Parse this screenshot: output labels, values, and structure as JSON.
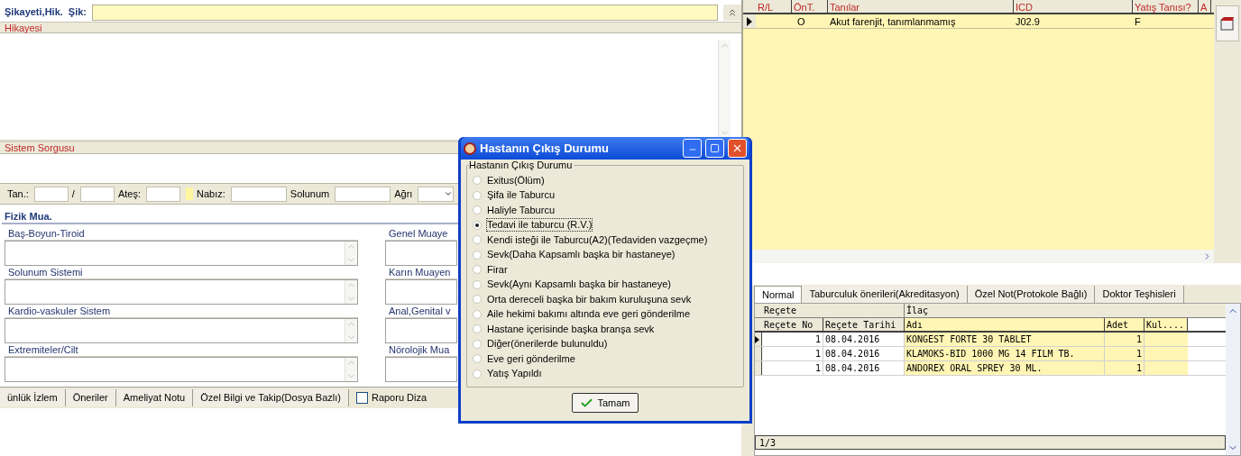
{
  "complaint": {
    "title": "Şikayeti,Hik.",
    "label": "Şik:"
  },
  "history": {
    "label": "Hikayesi"
  },
  "system_query": {
    "label": "Sistem Sorgusu"
  },
  "vitals": [
    {
      "label": "Tan.:",
      "kind": "field"
    },
    {
      "label": "/",
      "kind": "field"
    },
    {
      "label": "Ateş:",
      "kind": "field"
    },
    {
      "label": "Nabız:",
      "kind": "field",
      "marker": true
    },
    {
      "label": "Solunum",
      "kind": "field"
    },
    {
      "label": "Ağrı",
      "kind": "dropdown"
    }
  ],
  "physical_exam": {
    "title": "Fizik Mua.",
    "left_sections": [
      {
        "label": "Baş-Boyun-Tiroid"
      },
      {
        "label": "Solunum Sistemi"
      },
      {
        "label": "Kardio-vaskuler Sistem"
      },
      {
        "label": "Extremiteler/Cilt"
      }
    ],
    "right_sections": [
      {
        "label": "Genel Muaye"
      },
      {
        "label": "Karın Muayen"
      },
      {
        "label": "Anal,Genital v"
      },
      {
        "label": "Nörolojik Mua"
      }
    ]
  },
  "bottom_tabs": [
    {
      "label": "ünlük İzlem"
    },
    {
      "label": "Öneriler"
    },
    {
      "label": "Ameliyat Notu"
    },
    {
      "label": "Özel Bilgi ve Takip(Dosya Bazlı)"
    }
  ],
  "report_checkbox": {
    "label": "Raporu Diza",
    "checked": false
  },
  "dialog": {
    "title": "Hastanın Çıkış Durumu",
    "group_label": "Hastanın Çıkış Durumu",
    "options": [
      {
        "label": "Exitus(Ölüm)",
        "selected": false
      },
      {
        "label": "Şifa ile Taburcu",
        "selected": false
      },
      {
        "label": "Haliyle Taburcu",
        "selected": false
      },
      {
        "label": "Tedavi ile taburcu (R.V.)",
        "selected": true
      },
      {
        "label": "Kendi isteği ile Taburcu(A2)(Tedaviden vazgeçme)",
        "selected": false
      },
      {
        "label": "Sevk(Daha Kapsamlı başka bir hastaneye)",
        "selected": false
      },
      {
        "label": "Firar",
        "selected": false
      },
      {
        "label": "Sevk(Aynı Kapsamlı başka bir hastaneye)",
        "selected": false
      },
      {
        "label": "Orta dereceli başka bir  bakım kuruluşuna sevk",
        "selected": false
      },
      {
        "label": "Aile hekimi bakımı altında eve geri gönderilme",
        "selected": false
      },
      {
        "label": "Hastane içerisinde başka branşa sevk",
        "selected": false
      },
      {
        "label": "Diğer(önerilerde bulunuldu)",
        "selected": false
      },
      {
        "label": "Eve geri gönderilme",
        "selected": false
      },
      {
        "label": "Yatış Yapıldı",
        "selected": false
      }
    ],
    "ok_button": "Tamam"
  },
  "diagnoses": {
    "columns": [
      "R/L",
      "ÖnT.",
      "Tanılar",
      "ICD",
      "Yatış Tanısı?",
      "A"
    ],
    "rows": [
      {
        "current": true,
        "ont": "O",
        "diagnosis": "Akut farenjit, tanımlanmamış",
        "icd": "J02.9",
        "inpatient": "F"
      }
    ]
  },
  "lower_tabs": [
    {
      "label": "Normal",
      "selected": true
    },
    {
      "label": "Taburculuk önerileri(Akreditasyon)",
      "selected": false
    },
    {
      "label": "Özel Not(Protokole Bağlı)",
      "selected": false
    },
    {
      "label": "Doktor Teşhisleri",
      "selected": false
    }
  ],
  "prescriptions": {
    "groups": [
      "Reçete",
      "İlaç"
    ],
    "columns": [
      "Reçete No",
      "Reçete Tarihi",
      "Adı",
      "Adet",
      "Kul...."
    ],
    "rows": [
      {
        "current": true,
        "cells": [
          "1",
          "08.04.2016",
          "KONGEST FORTE 30 TABLET",
          "1"
        ]
      },
      {
        "current": false,
        "cells": [
          "1",
          "08.04.2016",
          "KLAMOKS-BID 1000 MG 14 FILM TB.",
          "1"
        ]
      },
      {
        "current": false,
        "cells": [
          "1",
          "08.04.2016",
          "ANDOREX ORAL SPREY 30 ML.",
          "1"
        ]
      }
    ],
    "footer": "1/3"
  }
}
